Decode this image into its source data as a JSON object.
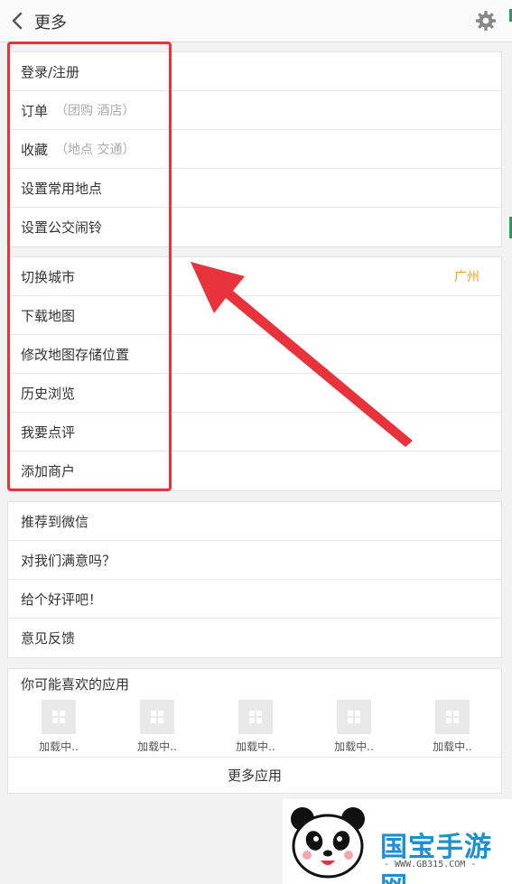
{
  "header": {
    "title": "更多"
  },
  "section_account": {
    "items": [
      {
        "label": "登录/注册",
        "sub": ""
      },
      {
        "label": "订单",
        "sub": "（团购  酒店）"
      },
      {
        "label": "收藏",
        "sub": "（地点  交通）"
      },
      {
        "label": "设置常用地点",
        "sub": ""
      },
      {
        "label": "设置公交闹铃",
        "sub": ""
      }
    ]
  },
  "section_map": {
    "items": [
      {
        "label": "切换城市",
        "value": "广州"
      },
      {
        "label": "下载地图",
        "value": ""
      },
      {
        "label": "修改地图存储位置",
        "value": ""
      },
      {
        "label": "历史浏览",
        "value": ""
      },
      {
        "label": "我要点评",
        "value": ""
      },
      {
        "label": "添加商户",
        "value": ""
      }
    ]
  },
  "section_feedback": {
    "items": [
      {
        "label": "推荐到微信"
      },
      {
        "label": "对我们满意吗？"
      },
      {
        "label": "给个好评吧！"
      },
      {
        "label": "意见反馈"
      }
    ]
  },
  "apps": {
    "title": "你可能喜欢的应用",
    "items": [
      {
        "label": "加载中.."
      },
      {
        "label": "加载中.."
      },
      {
        "label": "加载中.."
      },
      {
        "label": "加载中.."
      },
      {
        "label": "加载中.."
      }
    ],
    "more_label": "更多应用"
  },
  "watermark": {
    "brand": "国宝手游网",
    "url": "- WWW.GB315.COM -"
  },
  "colors": {
    "accent": "#f0a020",
    "annotation": "#e8333d",
    "brand": "#1f8fd0"
  },
  "icons": {
    "back": "chevron-left-icon",
    "settings": "gear-icon",
    "app": "grid-icon"
  }
}
